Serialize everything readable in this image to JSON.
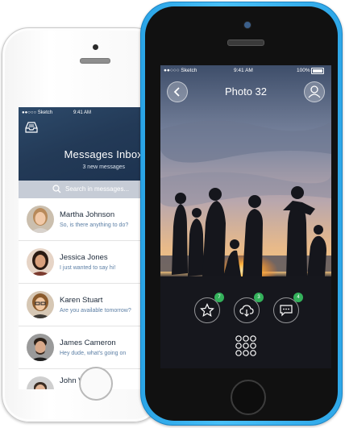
{
  "inbox_phone": {
    "status": {
      "carrier": "●●○○○ Sketch",
      "time": "9:41 AM"
    },
    "header": {
      "title": "Messages Inbox",
      "subtitle": "3 new messages"
    },
    "search": {
      "placeholder": "Search in messages..."
    },
    "messages": [
      {
        "name": "Martha Johnson",
        "preview": "So, is there anything to do?"
      },
      {
        "name": "Jessica Jones",
        "preview": "I just wanted to say hi!"
      },
      {
        "name": "Karen Stuart",
        "preview": "Are you available tomorrow?"
      },
      {
        "name": "James Cameron",
        "preview": "Hey dude, what's going on"
      },
      {
        "name": "John Wayne",
        "preview": ""
      }
    ],
    "icons": [
      "inbox-tray-icon",
      "search-icon"
    ]
  },
  "photo_phone": {
    "status": {
      "carrier": "●●○○○ Sketch",
      "time": "9:41 AM",
      "battery": "100%"
    },
    "nav": {
      "title": "Photo 32"
    },
    "actions": [
      {
        "name": "favorite",
        "icon": "star-icon",
        "count": "7"
      },
      {
        "name": "download",
        "icon": "cloud-download-icon",
        "count": "3"
      },
      {
        "name": "comments",
        "icon": "comment-icon",
        "count": "4"
      }
    ],
    "icons": [
      "back-chevron-icon",
      "profile-icon",
      "grid-menu-icon"
    ]
  },
  "colors": {
    "phone_blue": "#2ea7e8",
    "inbox_header": "#233a57",
    "search_bar": "#c6ccd6",
    "badge_green": "#34b15b",
    "preview_text": "#5c7fa5"
  }
}
